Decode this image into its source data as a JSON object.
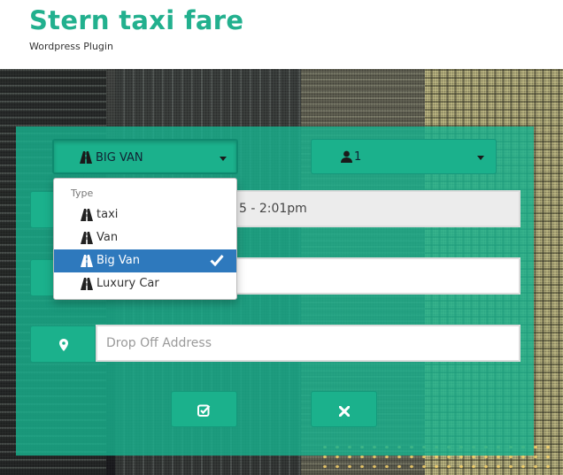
{
  "header": {
    "title": "Stern taxi fare",
    "subtitle": "Wordpress Plugin"
  },
  "form": {
    "car_type_select": {
      "selected": "BIG VAN",
      "icon": "road-icon"
    },
    "passengers_select": {
      "selected": "1",
      "icon": "user-icon"
    },
    "date_field": {
      "value": "5 - 2:01pm",
      "icon": "calendar-icon"
    },
    "pickup_field": {
      "value": "",
      "icon": "map-marker-icon"
    },
    "dropoff_field": {
      "placeholder": "Drop Off Address",
      "icon": "map-marker-icon"
    },
    "buttons": {
      "submit_icon": "check-square-icon",
      "reset_icon": "close-icon"
    }
  },
  "type_menu": {
    "header": "Type",
    "items": [
      {
        "label": "taxi",
        "icon": "road-icon",
        "selected": false
      },
      {
        "label": "Van",
        "icon": "road-icon",
        "selected": false
      },
      {
        "label": "Big Van",
        "icon": "road-icon",
        "selected": true
      },
      {
        "label": "Luxury Car",
        "icon": "road-icon",
        "selected": false
      }
    ]
  },
  "colors": {
    "accent": "#1bb18c",
    "title": "#22b08e",
    "menu_active": "#2e79bd"
  }
}
